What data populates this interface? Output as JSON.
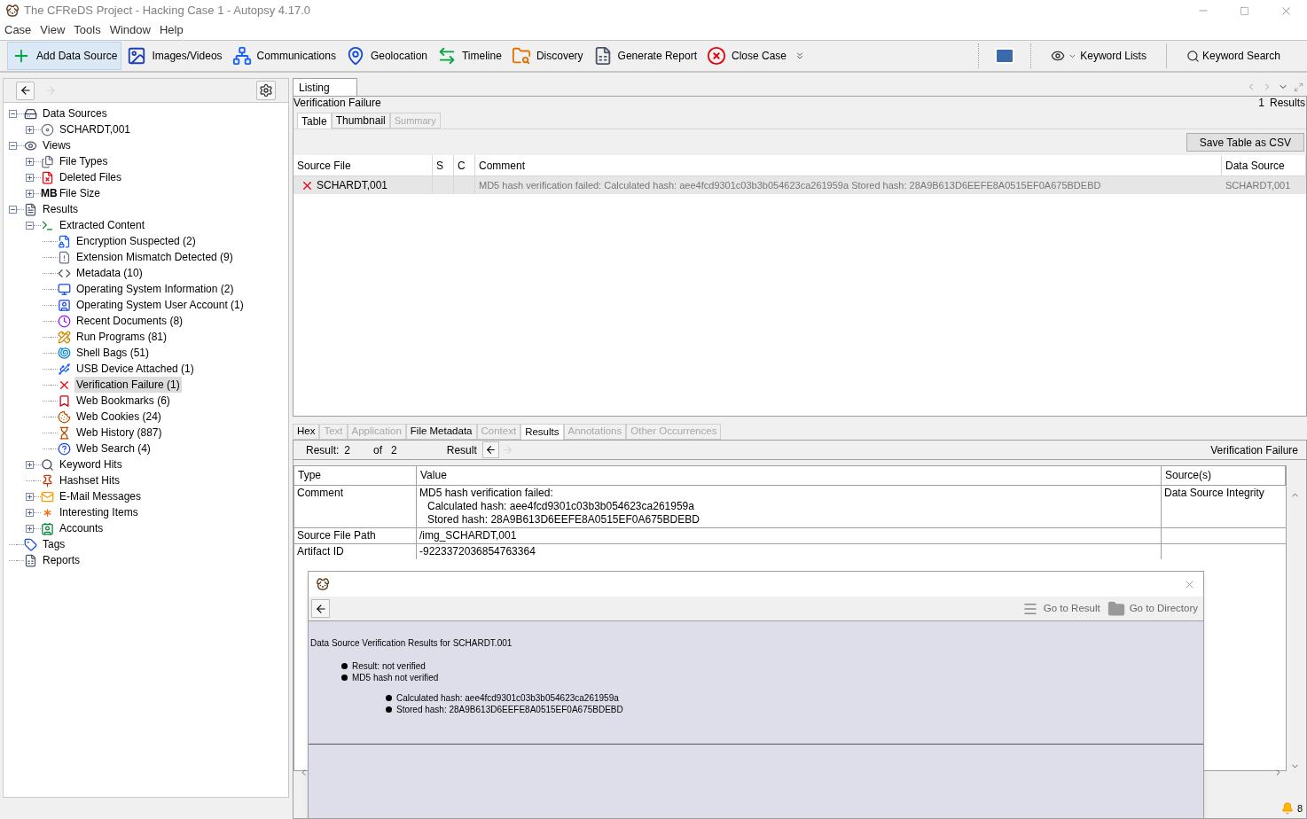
{
  "window": {
    "title": "The CFReDS Project - Hacking Case 1 - Autopsy 4.17.0"
  },
  "menu": [
    "Case",
    "View",
    "Tools",
    "Window",
    "Help"
  ],
  "toolbar": {
    "left": [
      {
        "kind": "add",
        "label": "Add Data Source",
        "highlighted": true
      },
      {
        "kind": "images",
        "label": "Images/Videos",
        "highlighted": false
      },
      {
        "kind": "communications",
        "label": "Communications",
        "highlighted": false
      },
      {
        "kind": "geolocation",
        "label": "Geolocation",
        "highlighted": false
      },
      {
        "kind": "timeline",
        "label": "Timeline",
        "highlighted": false
      },
      {
        "kind": "discovery",
        "label": "Discovery",
        "highlighted": false
      },
      {
        "kind": "report",
        "label": "Generate Report",
        "highlighted": false
      },
      {
        "kind": "close",
        "label": "Close Case",
        "highlighted": false
      }
    ],
    "keyword_lists": "Keyword Lists",
    "keyword_search": "Keyword Search"
  },
  "tree": {
    "items": [
      {
        "kind": "datasources",
        "label": "Data Sources",
        "selected": false,
        "expanded": true,
        "children": [
          {
            "kind": "disk",
            "label": "SCHARDT,001",
            "selected": false,
            "expanded": false
          }
        ]
      },
      {
        "kind": "views",
        "label": "Views",
        "selected": false,
        "expanded": true,
        "children": [
          {
            "kind": "filetypes",
            "label": "File Types",
            "selected": false,
            "expanded": false
          },
          {
            "kind": "deleted",
            "label": "Deleted Files",
            "selected": false,
            "expanded": false
          },
          {
            "kind": "size",
            "prefix": "MB",
            "label": "File Size",
            "selected": false,
            "expanded": false
          }
        ]
      },
      {
        "kind": "results",
        "label": "Results",
        "selected": false,
        "expanded": true,
        "children": [
          {
            "kind": "extracted",
            "label": "Extracted Content",
            "selected": false,
            "expanded": true,
            "children": [
              {
                "kind": "encryption",
                "label": "Encryption Suspected (2)",
                "selected": false
              },
              {
                "kind": "mismatch",
                "label": "Extension Mismatch Detected (9)",
                "selected": false
              },
              {
                "kind": "metadata",
                "label": "Metadata (10)",
                "selected": false
              },
              {
                "kind": "osinfo",
                "label": "Operating System Information (2)",
                "selected": false
              },
              {
                "kind": "osuser",
                "label": "Operating System User Account (1)",
                "selected": false
              },
              {
                "kind": "recent",
                "label": "Recent Documents (8)",
                "selected": false
              },
              {
                "kind": "programs",
                "label": "Run Programs (81)",
                "selected": false
              },
              {
                "kind": "shellbags",
                "label": "Shell Bags (51)",
                "selected": false
              },
              {
                "kind": "usb",
                "label": "USB Device Attached (1)",
                "selected": false
              },
              {
                "kind": "verification",
                "label": "Verification Failure (1)",
                "selected": true
              },
              {
                "kind": "bookmarks",
                "label": "Web Bookmarks (6)",
                "selected": false
              },
              {
                "kind": "cookies",
                "label": "Web Cookies (24)",
                "selected": false
              },
              {
                "kind": "history",
                "label": "Web History (887)",
                "selected": false
              },
              {
                "kind": "websearch",
                "label": "Web Search (4)",
                "selected": false
              }
            ]
          },
          {
            "kind": "keyword",
            "label": "Keyword Hits",
            "selected": false,
            "expanded": false
          },
          {
            "kind": "hashset",
            "label": "Hashset Hits",
            "selected": false
          },
          {
            "kind": "email",
            "label": "E-Mail Messages",
            "selected": false,
            "expanded": false
          },
          {
            "kind": "interesting",
            "label": "Interesting Items",
            "selected": false,
            "expanded": false
          },
          {
            "kind": "accounts",
            "label": "Accounts",
            "selected": false,
            "expanded": false
          }
        ]
      },
      {
        "kind": "tags",
        "label": "Tags",
        "selected": false
      },
      {
        "kind": "reports",
        "label": "Reports",
        "selected": false
      }
    ]
  },
  "listing": {
    "tab": "Listing",
    "title": "Verification Failure",
    "count": "1",
    "count_label": "Results",
    "view_tabs": [
      {
        "label": "Table",
        "selected": true,
        "disabled": false
      },
      {
        "label": "Thumbnail",
        "selected": false,
        "disabled": false
      },
      {
        "label": "Summary",
        "selected": false,
        "disabled": true
      }
    ],
    "save_button": "Save Table as CSV",
    "columns": [
      "Source File",
      "S",
      "C",
      "Comment",
      "Data Source"
    ],
    "rows": [
      {
        "source_file": "SCHARDT,001",
        "comment": "MD5 hash verification failed:  Calculated hash: aee4fcd9301c03b3b054623ca261959a  Stored hash: 28A9B613D6EEFE8A0515EF0A675BDEBD",
        "data_source": "SCHARDT,001",
        "selected": true
      }
    ]
  },
  "content_viewer": {
    "tabs": [
      {
        "label": "Hex",
        "selected": false,
        "disabled": false
      },
      {
        "label": "Text",
        "selected": false,
        "disabled": true
      },
      {
        "label": "Application",
        "selected": false,
        "disabled": true
      },
      {
        "label": "File Metadata",
        "selected": false,
        "disabled": false
      },
      {
        "label": "Context",
        "selected": false,
        "disabled": true
      },
      {
        "label": "Results",
        "selected": true,
        "disabled": false
      },
      {
        "label": "Annotations",
        "selected": false,
        "disabled": true
      },
      {
        "label": "Other Occurrences",
        "selected": false,
        "disabled": true
      }
    ],
    "result_label": "Result:",
    "result_index": "2",
    "of_label": "of",
    "result_total": "2",
    "nav_label": "Result",
    "artifact_type": "Verification Failure",
    "columns": [
      "Type",
      "Value",
      "Source(s)"
    ],
    "rows": [
      {
        "type": "Comment",
        "value": "MD5 hash verification failed:",
        "value_details": [
          "Calculated hash: aee4fcd9301c03b3b054623ca261959a",
          "Stored hash: 28A9B613D6EEFE8A0515EF0A675BDEBD"
        ],
        "source": "Data Source Integrity"
      },
      {
        "type": "Source File Path",
        "value": "/img_SCHARDT,001"
      },
      {
        "type": "Artifact ID",
        "value": "-9223372036854763364"
      }
    ]
  },
  "dialog": {
    "go_to_result": "Go to Result",
    "go_to_directory": "Go to Directory",
    "heading": "Data Source Verification Results for SCHARDT.001",
    "bullets": [
      {
        "text": "Result: not verified"
      },
      {
        "text": "MD5 hash not verified",
        "children": [
          {
            "text": "Calculated hash: aee4fcd9301c03b3b054623ca261959a"
          },
          {
            "text": "Stored hash: 28A9B613D6EEFE8A0515EF0A675BDEBD"
          }
        ]
      }
    ]
  },
  "status_bar": {
    "notifications": "8"
  }
}
